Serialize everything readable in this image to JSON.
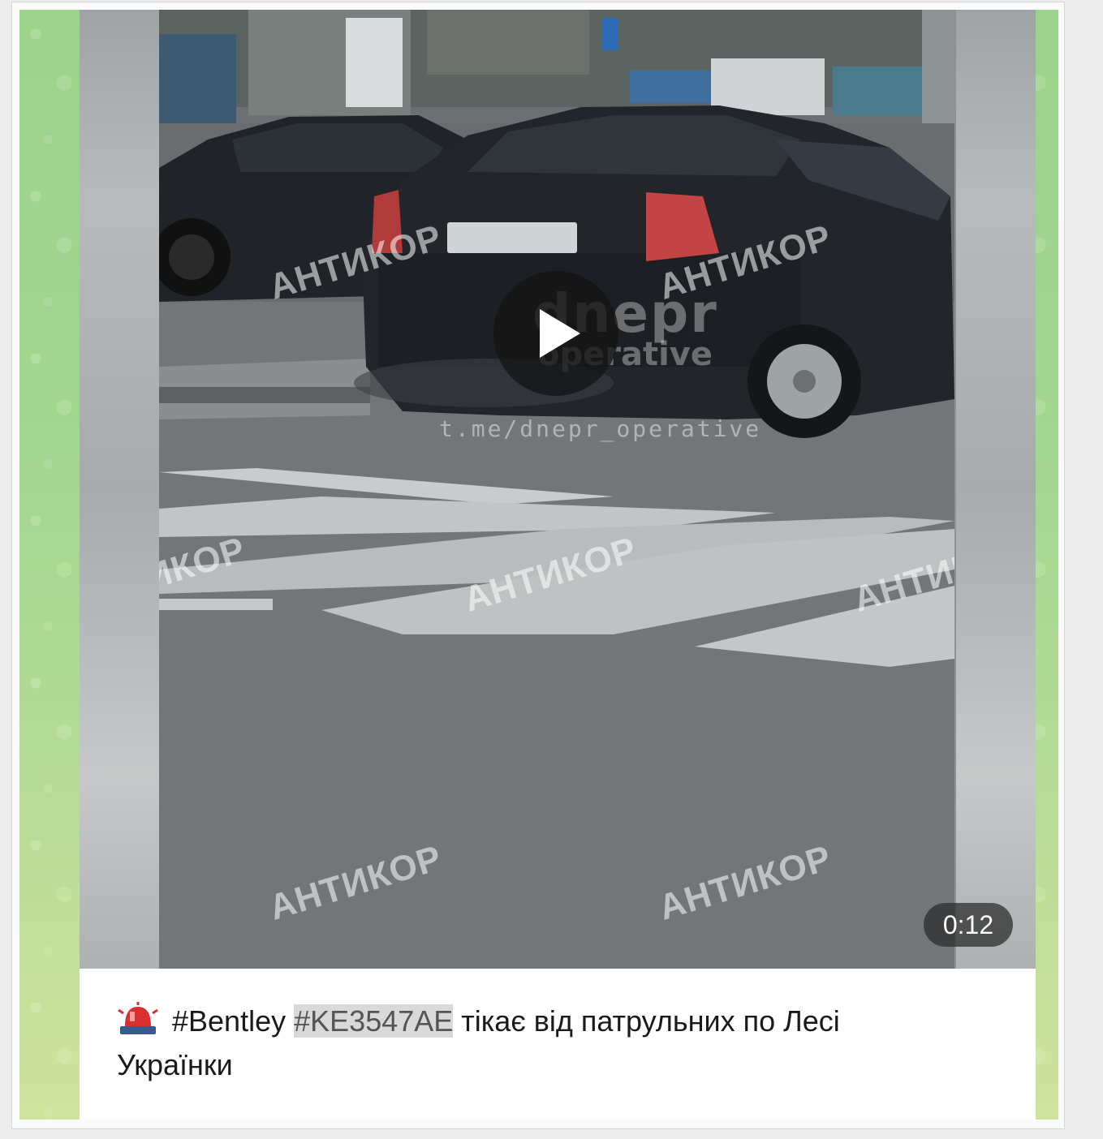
{
  "video": {
    "duration": "0:12",
    "watermark": "АНТИКОР",
    "channel_logo_line1": "dnepr",
    "channel_logo_line2": "operative",
    "channel_url": "t.me/dnepr_operative"
  },
  "caption": {
    "hashtag1": "#Bentley",
    "hashtag2": "#KE3547AE",
    "text_line1": " тікає від патрульних по Лесі",
    "text_line2": "Українки"
  },
  "colors": {
    "chat_background": "#a3d68f",
    "play_button": "#141414",
    "highlight": "#d9d9d9"
  },
  "icons": {
    "play": "play-icon",
    "emoji": "emergency-light-emoji"
  }
}
